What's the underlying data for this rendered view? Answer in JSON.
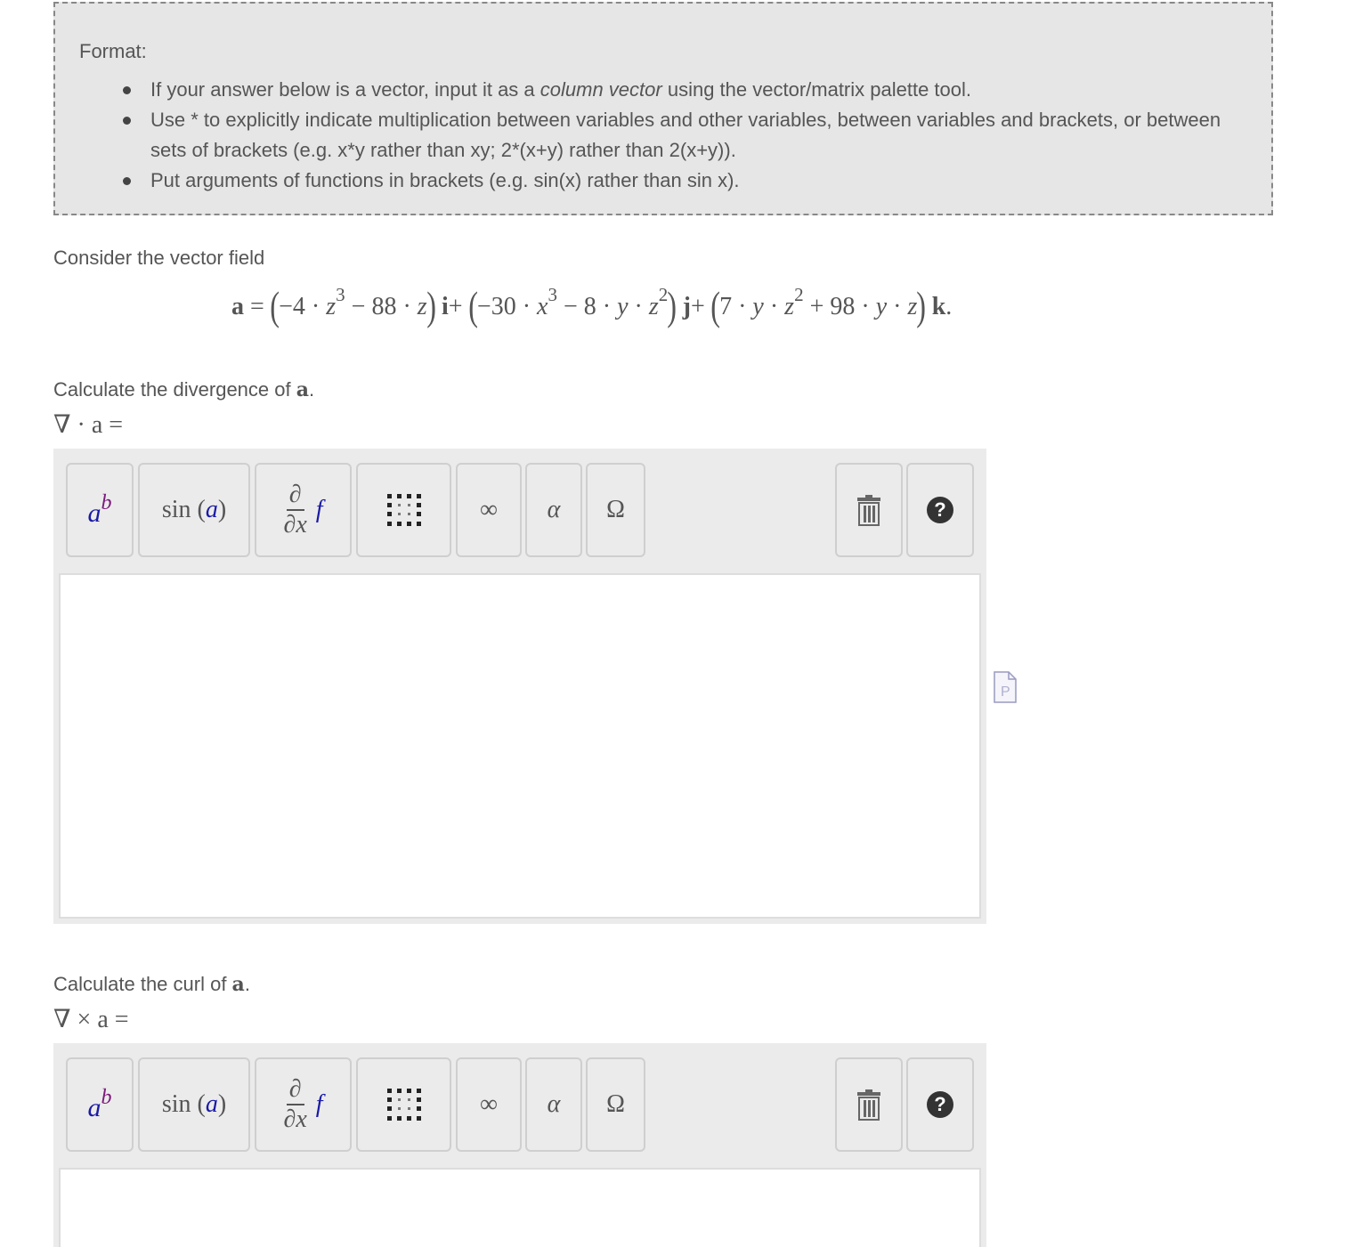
{
  "format": {
    "title": "Format:",
    "bullets": {
      "b1_before": "If your answer below is a vector, input it as a ",
      "b1_em": "column vector",
      "b1_after": " using the vector/matrix palette tool.",
      "b2": "Use * to explicitly indicate multiplication between variables and other variables, between variables and brackets, or between sets of brackets (e.g. x*y rather than xy; 2*(x+y) rather than 2(x+y)).",
      "b3": "Put arguments of functions in brackets (e.g. sin(x) rather than sin x)."
    }
  },
  "question": {
    "intro": "Consider the vector field",
    "equation": {
      "lhs": "a",
      "eq": "=",
      "i_term": {
        "t1": "−4 · ",
        "z1": "z",
        "e1": "3",
        "t2": " − 88 · ",
        "z2": "z"
      },
      "j_term": {
        "t1": "−30 · ",
        "x1": "x",
        "e1": "3",
        "t2": " − 8 · ",
        "y": "y",
        "dot": " · ",
        "z": "z",
        "e2": "2"
      },
      "k_term": {
        "t1": "7 · ",
        "y1": "y",
        "dot1": " · ",
        "z1": "z",
        "e1": "2",
        "t2": " + 98 · ",
        "y2": "y",
        "dot2": " · ",
        "z2": "z"
      },
      "unit_i": "i",
      "unit_j": "j",
      "unit_k": "k",
      "plus": "+",
      "period": "."
    },
    "part1": {
      "prompt": "Calculate the divergence of ",
      "bold": "a",
      "period": ".",
      "lhs": "∇ · a ="
    },
    "part2": {
      "prompt": "Calculate the curl of ",
      "bold": "a",
      "period": ".",
      "lhs": "∇ × a ="
    }
  },
  "toolbar": {
    "power": {
      "base": "a",
      "exp": "b"
    },
    "function": {
      "name": "sin",
      "open": "(",
      "arg": "a",
      "close": ")"
    },
    "derivative": {
      "num": "∂",
      "den_d": "∂",
      "den_x": "x",
      "f": "f"
    },
    "infinity": "∞",
    "alpha": "α",
    "omega": "Ω",
    "help": "?",
    "icons": [
      "matrix-icon",
      "trash-icon",
      "help-icon",
      "document-icon"
    ]
  },
  "colors": {
    "format_bg": "#e6e6e6",
    "editor_bg": "#ebebeb",
    "text": "#555555",
    "math_blue": "#1a1aa6",
    "math_purple": "#7b1b7b"
  }
}
